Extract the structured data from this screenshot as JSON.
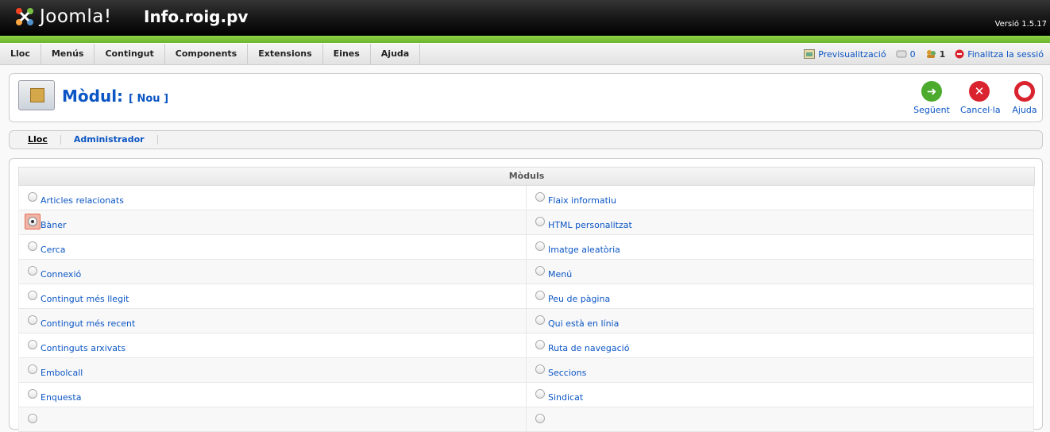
{
  "header": {
    "brand": "Joomla!",
    "site_name": "Info.roig.pv",
    "version": "Versió 1.5.17"
  },
  "menu": [
    "Lloc",
    "Menús",
    "Contingut",
    "Components",
    "Extensions",
    "Eines",
    "Ajuda"
  ],
  "status": {
    "preview": "Previsualització",
    "messages": "0",
    "users": "1",
    "logout": "Finalitza la sessió"
  },
  "title": {
    "main": "Mòdul:",
    "sub": "[ Nou ]"
  },
  "toolbar": {
    "next": "Següent",
    "cancel": "Cancel·la",
    "help": "Ajuda"
  },
  "tabs": [
    "Lloc",
    "Administrador"
  ],
  "modules": {
    "header": "Mòduls",
    "left": [
      "Articles relacionats",
      "Bàner",
      "Cerca",
      "Connexió",
      "Contingut més llegit",
      "Contingut més recent",
      "Continguts arxivats",
      "Embolcall",
      "Enquesta"
    ],
    "right": [
      "Flaix informatiu",
      "HTML personalitzat",
      "Imatge aleatòria",
      "Menú",
      "Peu de pàgina",
      "Qui està en línia",
      "Ruta de navegació",
      "Seccions",
      "Sindicat"
    ],
    "selected": "Bàner"
  },
  "colors": {
    "accent": "#0b55c4",
    "header_green": "#6bb42b",
    "next": "#4caa2c",
    "cancel": "#d9232e",
    "help": "#d9232e"
  }
}
